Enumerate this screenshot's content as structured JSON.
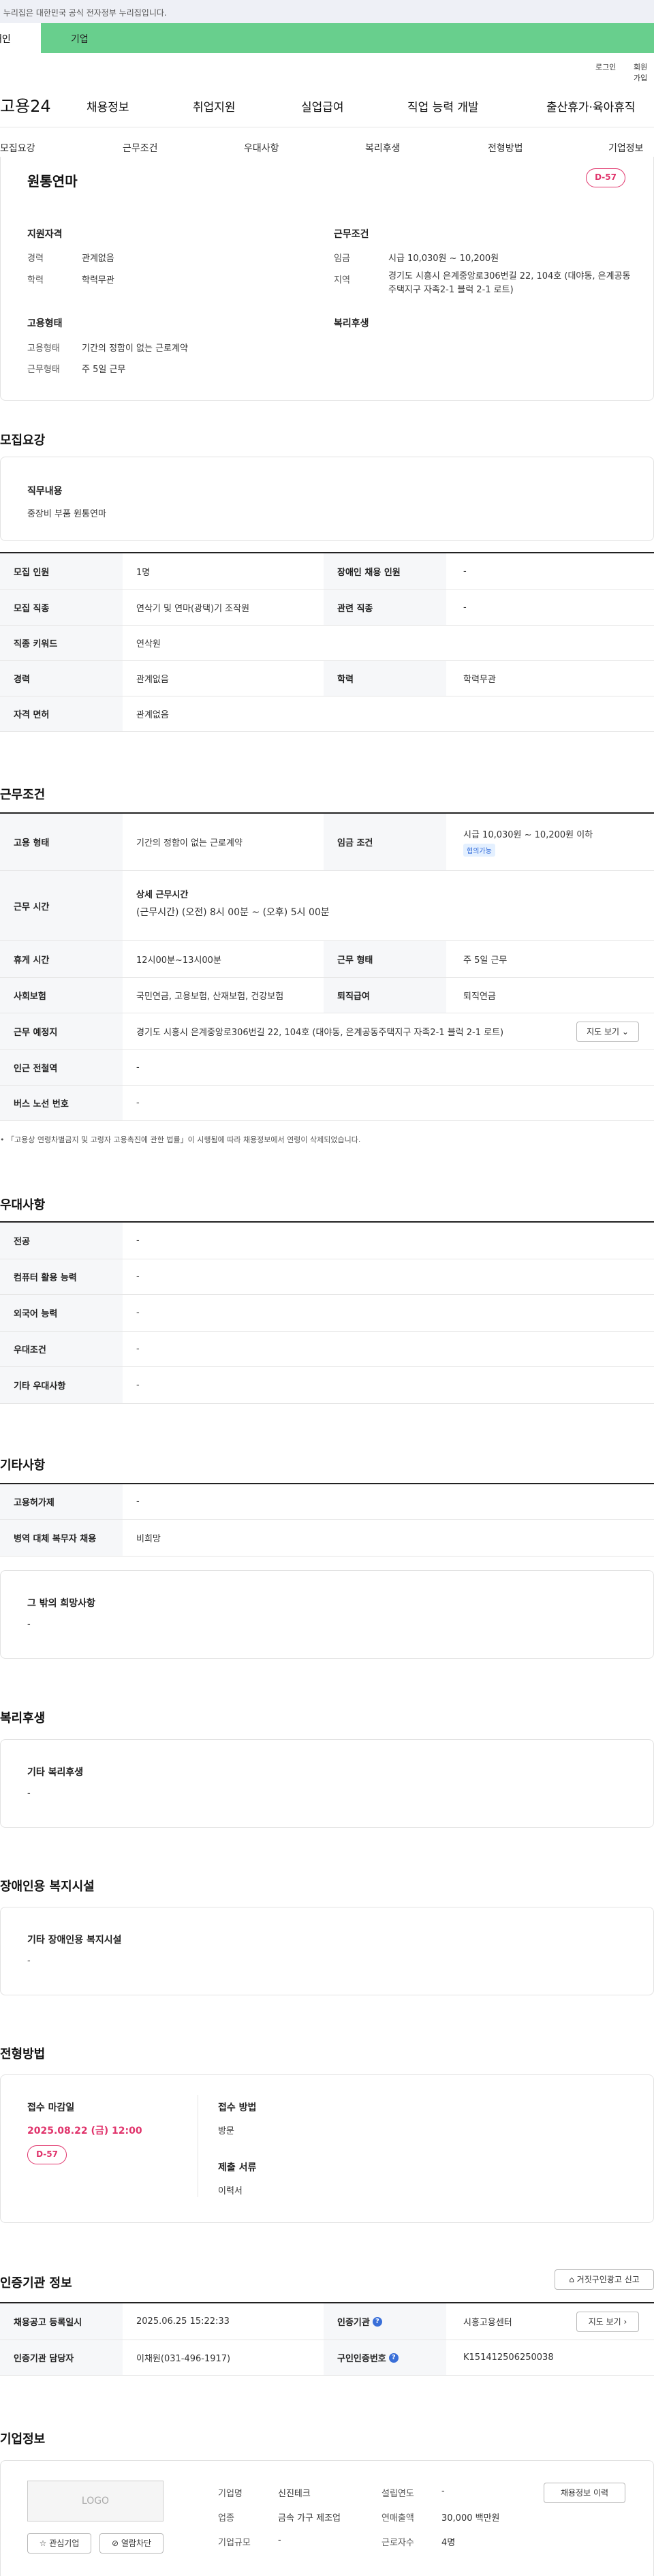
{
  "gov_banner": "이 누리집은 대한민국 공식 전자정부 누리집입니다.",
  "user_tabs": {
    "person": "개인",
    "corp": "기업"
  },
  "util": {
    "login": "로그인",
    "join": "회원가입"
  },
  "logo": "고용24",
  "gnb": [
    "채용정보",
    "취업지원",
    "실업급여",
    "직업 능력 개발",
    "출산휴가·육아휴직"
  ],
  "subnav": [
    "모집요강",
    "근무조건",
    "우대사항",
    "복리후생",
    "전형방법",
    "기업정보"
  ],
  "summary": {
    "title": "원통연마",
    "dday": "D-57",
    "qual_h": "지원자격",
    "exp_l": "경력",
    "exp_v": "관계없음",
    "edu_l": "학력",
    "edu_v": "학력무관",
    "cond_h": "근무조건",
    "wage_l": "임금",
    "wage_v": "시급 10,030원 ~ 10,200원",
    "loc_l": "지역",
    "loc_v": "경기도 시흥시 은계중앙로306번길 22, 104호 (대야동, 은계공동주택지구 자족2-1 블럭 2-1 로트)",
    "emp_h": "고용형태",
    "etype_l": "고용형태",
    "etype_v": "기간의 정함이 없는 근로계약",
    "wtype_l": "근무형태",
    "wtype_v": "주 5일 근무",
    "welfare_h": "복리후생"
  },
  "recruit": {
    "title": "모집요강",
    "duty_h": "직무내용",
    "duty_v": "중장비 부품 원통연마",
    "rows": [
      {
        "th": "모집 인원",
        "td": "1명",
        "th2": "장애인 채용 인원",
        "td2": "-"
      },
      {
        "th": "모집 직종",
        "td": "연삭기 및 연마(광택)기 조작원",
        "th2": "관련 직종",
        "td2": "-"
      },
      {
        "th": "직종 키워드",
        "td": "연삭원"
      },
      {
        "th": "경력",
        "td": "관계없음",
        "th2": "학력",
        "td2": "학력무관"
      },
      {
        "th": "자격 면허",
        "td": "관계없음"
      }
    ]
  },
  "conditions": {
    "title": "근무조건",
    "etype_th": "고용 형태",
    "etype_td": "기간의 정함이 없는 근로계약",
    "wage_th": "임금 조건",
    "wage_td": "시급 10,030원 ~ 10,200원 이하",
    "wage_badge": "협의가능",
    "hours_th": "근무 시간",
    "hours_h": "상세 근무시간",
    "hours_td": "(근무시간) (오전) 8시 00분 ~ (오후) 5시 00분",
    "rest_th": "휴게 시간",
    "rest_td": "12시00분~13시00분",
    "wtype_th": "근무 형태",
    "wtype_td": "주 5일 근무",
    "ins_th": "사회보험",
    "ins_td": "국민연금, 고용보험, 산재보험, 건강보험",
    "sev_th": "퇴직급여",
    "sev_td": "퇴직연금",
    "place_th": "근무 예정지",
    "place_td": "경기도 시흥시 은계중앙로306번길 22, 104호 (대야동, 은계공동주택지구 자족2-1 블럭 2-1 로트)",
    "map_btn": "지도 보기",
    "station_th": "인근 전철역",
    "station_td": "-",
    "bus_th": "버스 노선 번호",
    "bus_td": "-",
    "note": "「고용상 연령차별금지 및 고령자 고용촉진에 관한 법률」이 시행됨에 따라 채용정보에서 연령이 삭제되었습니다."
  },
  "preferences": {
    "title": "우대사항",
    "rows": [
      {
        "th": "전공",
        "td": "-"
      },
      {
        "th": "컴퓨터 활용 능력",
        "td": "-"
      },
      {
        "th": "외국어 능력",
        "td": "-"
      },
      {
        "th": "우대조건",
        "td": "-"
      },
      {
        "th": "기타 우대사항",
        "td": "-"
      }
    ]
  },
  "etc": {
    "title": "기타사항",
    "rows": [
      {
        "th": "고용허가제",
        "td": "-"
      },
      {
        "th": "병역 대체 복무자 채용",
        "td": "비희망"
      }
    ],
    "wish_h": "그 밖의 희망사항",
    "wish_v": "-"
  },
  "welfare": {
    "title": "복리후생",
    "h": "기타 복리후생",
    "v": "-"
  },
  "disabled": {
    "title": "장애인용 복지시설",
    "h": "기타 장애인용 복지시설",
    "v": "-"
  },
  "selection": {
    "title": "전형방법",
    "deadline_h": "접수 마감일",
    "deadline_v": "2025.08.22 (금) 12:00",
    "dday": "D-57",
    "method_h": "접수 방법",
    "method_v": "방문",
    "docs_h": "제출 서류",
    "docs_v": "이력서"
  },
  "cert": {
    "title": "인증기관 정보",
    "report_btn": "거짓구인광고 신고",
    "reg_th": "채용공고 등록일시",
    "reg_td": "2025.06.25 15:22:33",
    "org_th": "인증기관",
    "org_td": "시흥고용센터",
    "map_btn": "지도 보기",
    "mgr_th": "인증기관 담당자",
    "mgr_td": "이채원(031-496-1917)",
    "no_th": "구인인증번호",
    "no_td": "K151412506250038"
  },
  "company": {
    "title": "기업정보",
    "logo": "LOGO",
    "fav_btn": "관심기업",
    "block_btn": "열람차단",
    "history_btn": "채용정보 이력",
    "name_l": "기업명",
    "name_v": "신진테크",
    "year_l": "설립연도",
    "year_v": "-",
    "ind_l": "업종",
    "ind_v": "금속 가구 제조업",
    "sales_l": "연매출액",
    "sales_v": "30,000 백만원",
    "size_l": "기업규모",
    "size_v": "-",
    "staff_l": "근로자수",
    "staff_v": "4명"
  }
}
